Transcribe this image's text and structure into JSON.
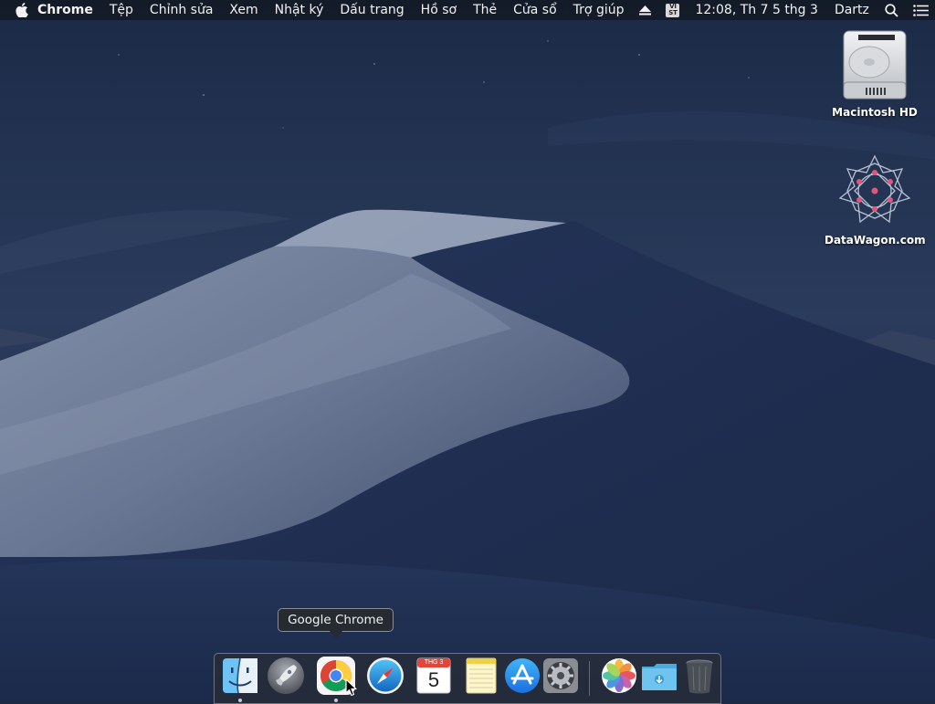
{
  "menubar": {
    "app_name": "Chrome",
    "items": [
      {
        "label": "Tệp"
      },
      {
        "label": "Chỉnh sửa"
      },
      {
        "label": "Xem"
      },
      {
        "label": "Nhật ký"
      },
      {
        "label": "Dấu trang"
      },
      {
        "label": "Hồ sơ"
      },
      {
        "label": "Thẻ"
      },
      {
        "label": "Cửa sổ"
      },
      {
        "label": "Trợ giúp"
      }
    ],
    "input_method": {
      "line1": "VI",
      "line2": "ST"
    },
    "clock": "12:08, Th 7 5 thg 3",
    "user": "Dartz"
  },
  "desktop": {
    "icons": [
      {
        "label": "Macintosh HD",
        "icon": "hard-drive-icon"
      },
      {
        "label": "DataWagon.com",
        "icon": "geometric-star-icon"
      }
    ]
  },
  "tooltip": {
    "text": "Google Chrome"
  },
  "dock": {
    "items": [
      {
        "name": "Finder",
        "icon": "finder-icon",
        "running": true
      },
      {
        "name": "Launchpad",
        "icon": "launchpad-icon",
        "running": false
      },
      {
        "name": "Google Chrome",
        "icon": "chrome-icon",
        "running": true
      },
      {
        "name": "Safari",
        "icon": "safari-icon",
        "running": false
      },
      {
        "name": "Calendar",
        "icon": "calendar-icon",
        "running": false,
        "month": "THG 3",
        "day": "5"
      },
      {
        "name": "Notes",
        "icon": "notes-icon",
        "running": false
      },
      {
        "name": "App Store",
        "icon": "app-store-icon",
        "running": false
      },
      {
        "name": "System Preferences",
        "icon": "system-preferences-icon",
        "running": false
      },
      {
        "name": "Photos",
        "icon": "photos-icon",
        "running": false
      },
      {
        "name": "Downloads",
        "icon": "downloads-folder-icon",
        "running": false
      },
      {
        "name": "Trash",
        "icon": "trash-icon",
        "running": false
      }
    ]
  },
  "colors": {
    "menubar_bg": "#14182280",
    "sky": "#1d2c48",
    "dune_light": "#6f7d97",
    "tooltip_bg": "#262a31"
  }
}
